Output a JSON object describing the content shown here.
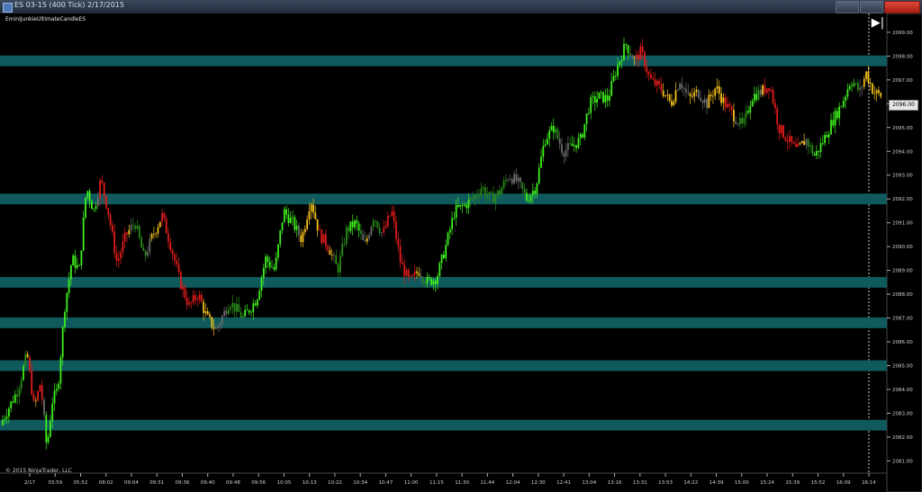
{
  "window": {
    "title": "ES 03-15 (400 Tick)  2/17/2015",
    "indicator_label": "EminiJunkieUltimateCandleES",
    "copyright": "© 2015 NinjaTrader, LLC",
    "scroll_to_end_glyph": "▶|",
    "icons": [
      "chart-window-icon",
      "minimize-icon",
      "maximize-icon",
      "close-icon",
      "scroll-to-end-icon"
    ]
  },
  "colors": {
    "background": "#000000",
    "zone": "#0f5a5d",
    "bright_green": "#3ef01c",
    "dark_green": "#2a8a1a",
    "yellow": "#f5c21b",
    "red": "#e01b1b",
    "gray": "#6a6a6a"
  },
  "chart_data": {
    "type": "candlestick",
    "title": "ES 03-15 (400 Tick)  2/17/2015",
    "ylim": [
      2080.6,
      2099.6
    ],
    "y_ticks": [
      "2099.00",
      "2098.00",
      "2097.00",
      "2096.00",
      "2095.00",
      "2094.00",
      "2093.00",
      "2092.00",
      "2091.00",
      "2090.00",
      "2089.00",
      "2088.00",
      "2087.00",
      "2086.00",
      "2085.00",
      "2084.00",
      "2083.00",
      "2082.00",
      "2081.00"
    ],
    "x_ticks": [
      "2/17",
      "03:59",
      "05:52",
      "08:02",
      "09:04",
      "09:31",
      "09:36",
      "09:40",
      "09:48",
      "09:56",
      "10:05",
      "10:13",
      "10:22",
      "10:34",
      "10:47",
      "11:00",
      "11:15",
      "11:30",
      "11:44",
      "12:04",
      "12:30",
      "12:41",
      "13:04",
      "13:16",
      "13:31",
      "13:53",
      "14:22",
      "14:39",
      "15:00",
      "15:24",
      "15:39",
      "15:52",
      "16:09",
      "16:14"
    ],
    "last_price": "2096.00",
    "support_resistance_zones": [
      {
        "price": 2097.8,
        "thickness": 0.45
      },
      {
        "price": 2092.0,
        "thickness": 0.45
      },
      {
        "price": 2088.5,
        "thickness": 0.45
      },
      {
        "price": 2086.8,
        "thickness": 0.45
      },
      {
        "price": 2085.0,
        "thickness": 0.45
      },
      {
        "price": 2082.5,
        "thickness": 0.45
      }
    ],
    "price_path": [
      [
        0,
        2082.5
      ],
      [
        20,
        2084.0
      ],
      [
        30,
        2085.5
      ],
      [
        38,
        2083.2
      ],
      [
        45,
        2084.3
      ],
      [
        52,
        2081.5
      ],
      [
        58,
        2083.5
      ],
      [
        64,
        2084.0
      ],
      [
        72,
        2087.5
      ],
      [
        80,
        2089.5
      ],
      [
        88,
        2089.0
      ],
      [
        96,
        2092.5
      ],
      [
        104,
        2091.5
      ],
      [
        112,
        2092.8
      ],
      [
        120,
        2091.5
      ],
      [
        130,
        2089.3
      ],
      [
        140,
        2090.5
      ],
      [
        150,
        2091.0
      ],
      [
        160,
        2089.5
      ],
      [
        170,
        2090.5
      ],
      [
        180,
        2091.3
      ],
      [
        190,
        2090.0
      ],
      [
        200,
        2088.5
      ],
      [
        210,
        2087.5
      ],
      [
        220,
        2088.0
      ],
      [
        230,
        2087.0
      ],
      [
        240,
        2086.5
      ],
      [
        255,
        2087.7
      ],
      [
        270,
        2087.0
      ],
      [
        285,
        2087.8
      ],
      [
        295,
        2089.5
      ],
      [
        305,
        2089.0
      ],
      [
        315,
        2091.5
      ],
      [
        325,
        2091.0
      ],
      [
        335,
        2090.3
      ],
      [
        345,
        2092.0
      ],
      [
        355,
        2090.5
      ],
      [
        365,
        2090.0
      ],
      [
        375,
        2089.0
      ],
      [
        385,
        2090.7
      ],
      [
        395,
        2091.0
      ],
      [
        405,
        2090.0
      ],
      [
        415,
        2091.3
      ],
      [
        425,
        2090.5
      ],
      [
        435,
        2091.5
      ],
      [
        445,
        2089.3
      ],
      [
        455,
        2088.5
      ],
      [
        465,
        2089.0
      ],
      [
        475,
        2088.5
      ],
      [
        485,
        2088.7
      ],
      [
        495,
        2090.0
      ],
      [
        505,
        2091.5
      ],
      [
        515,
        2091.7
      ],
      [
        525,
        2092.0
      ],
      [
        535,
        2092.5
      ],
      [
        545,
        2092.0
      ],
      [
        555,
        2092.3
      ],
      [
        565,
        2093.0
      ],
      [
        575,
        2092.7
      ],
      [
        585,
        2092.0
      ],
      [
        595,
        2092.5
      ],
      [
        605,
        2094.5
      ],
      [
        615,
        2095.0
      ],
      [
        625,
        2094.0
      ],
      [
        635,
        2094.2
      ],
      [
        645,
        2094.5
      ],
      [
        655,
        2096.0
      ],
      [
        665,
        2096.3
      ],
      [
        675,
        2096.2
      ],
      [
        685,
        2097.5
      ],
      [
        695,
        2098.5
      ],
      [
        705,
        2097.8
      ],
      [
        712,
        2098.2
      ],
      [
        722,
        2097.0
      ],
      [
        735,
        2096.6
      ],
      [
        745,
        2096.0
      ],
      [
        755,
        2097.0
      ],
      [
        765,
        2096.2
      ],
      [
        775,
        2096.5
      ],
      [
        785,
        2096.0
      ],
      [
        795,
        2096.7
      ],
      [
        805,
        2096.0
      ],
      [
        815,
        2095.5
      ],
      [
        825,
        2095.0
      ],
      [
        835,
        2096.3
      ],
      [
        845,
        2096.5
      ],
      [
        855,
        2096.8
      ],
      [
        865,
        2095.0
      ],
      [
        875,
        2094.5
      ],
      [
        885,
        2094.0
      ],
      [
        895,
        2094.5
      ],
      [
        905,
        2093.8
      ],
      [
        915,
        2094.5
      ],
      [
        925,
        2095.3
      ],
      [
        935,
        2096.0
      ],
      [
        945,
        2097.0
      ],
      [
        955,
        2096.5
      ],
      [
        962,
        2097.3
      ],
      [
        970,
        2096.5
      ],
      [
        980,
        2096.3
      ]
    ]
  }
}
